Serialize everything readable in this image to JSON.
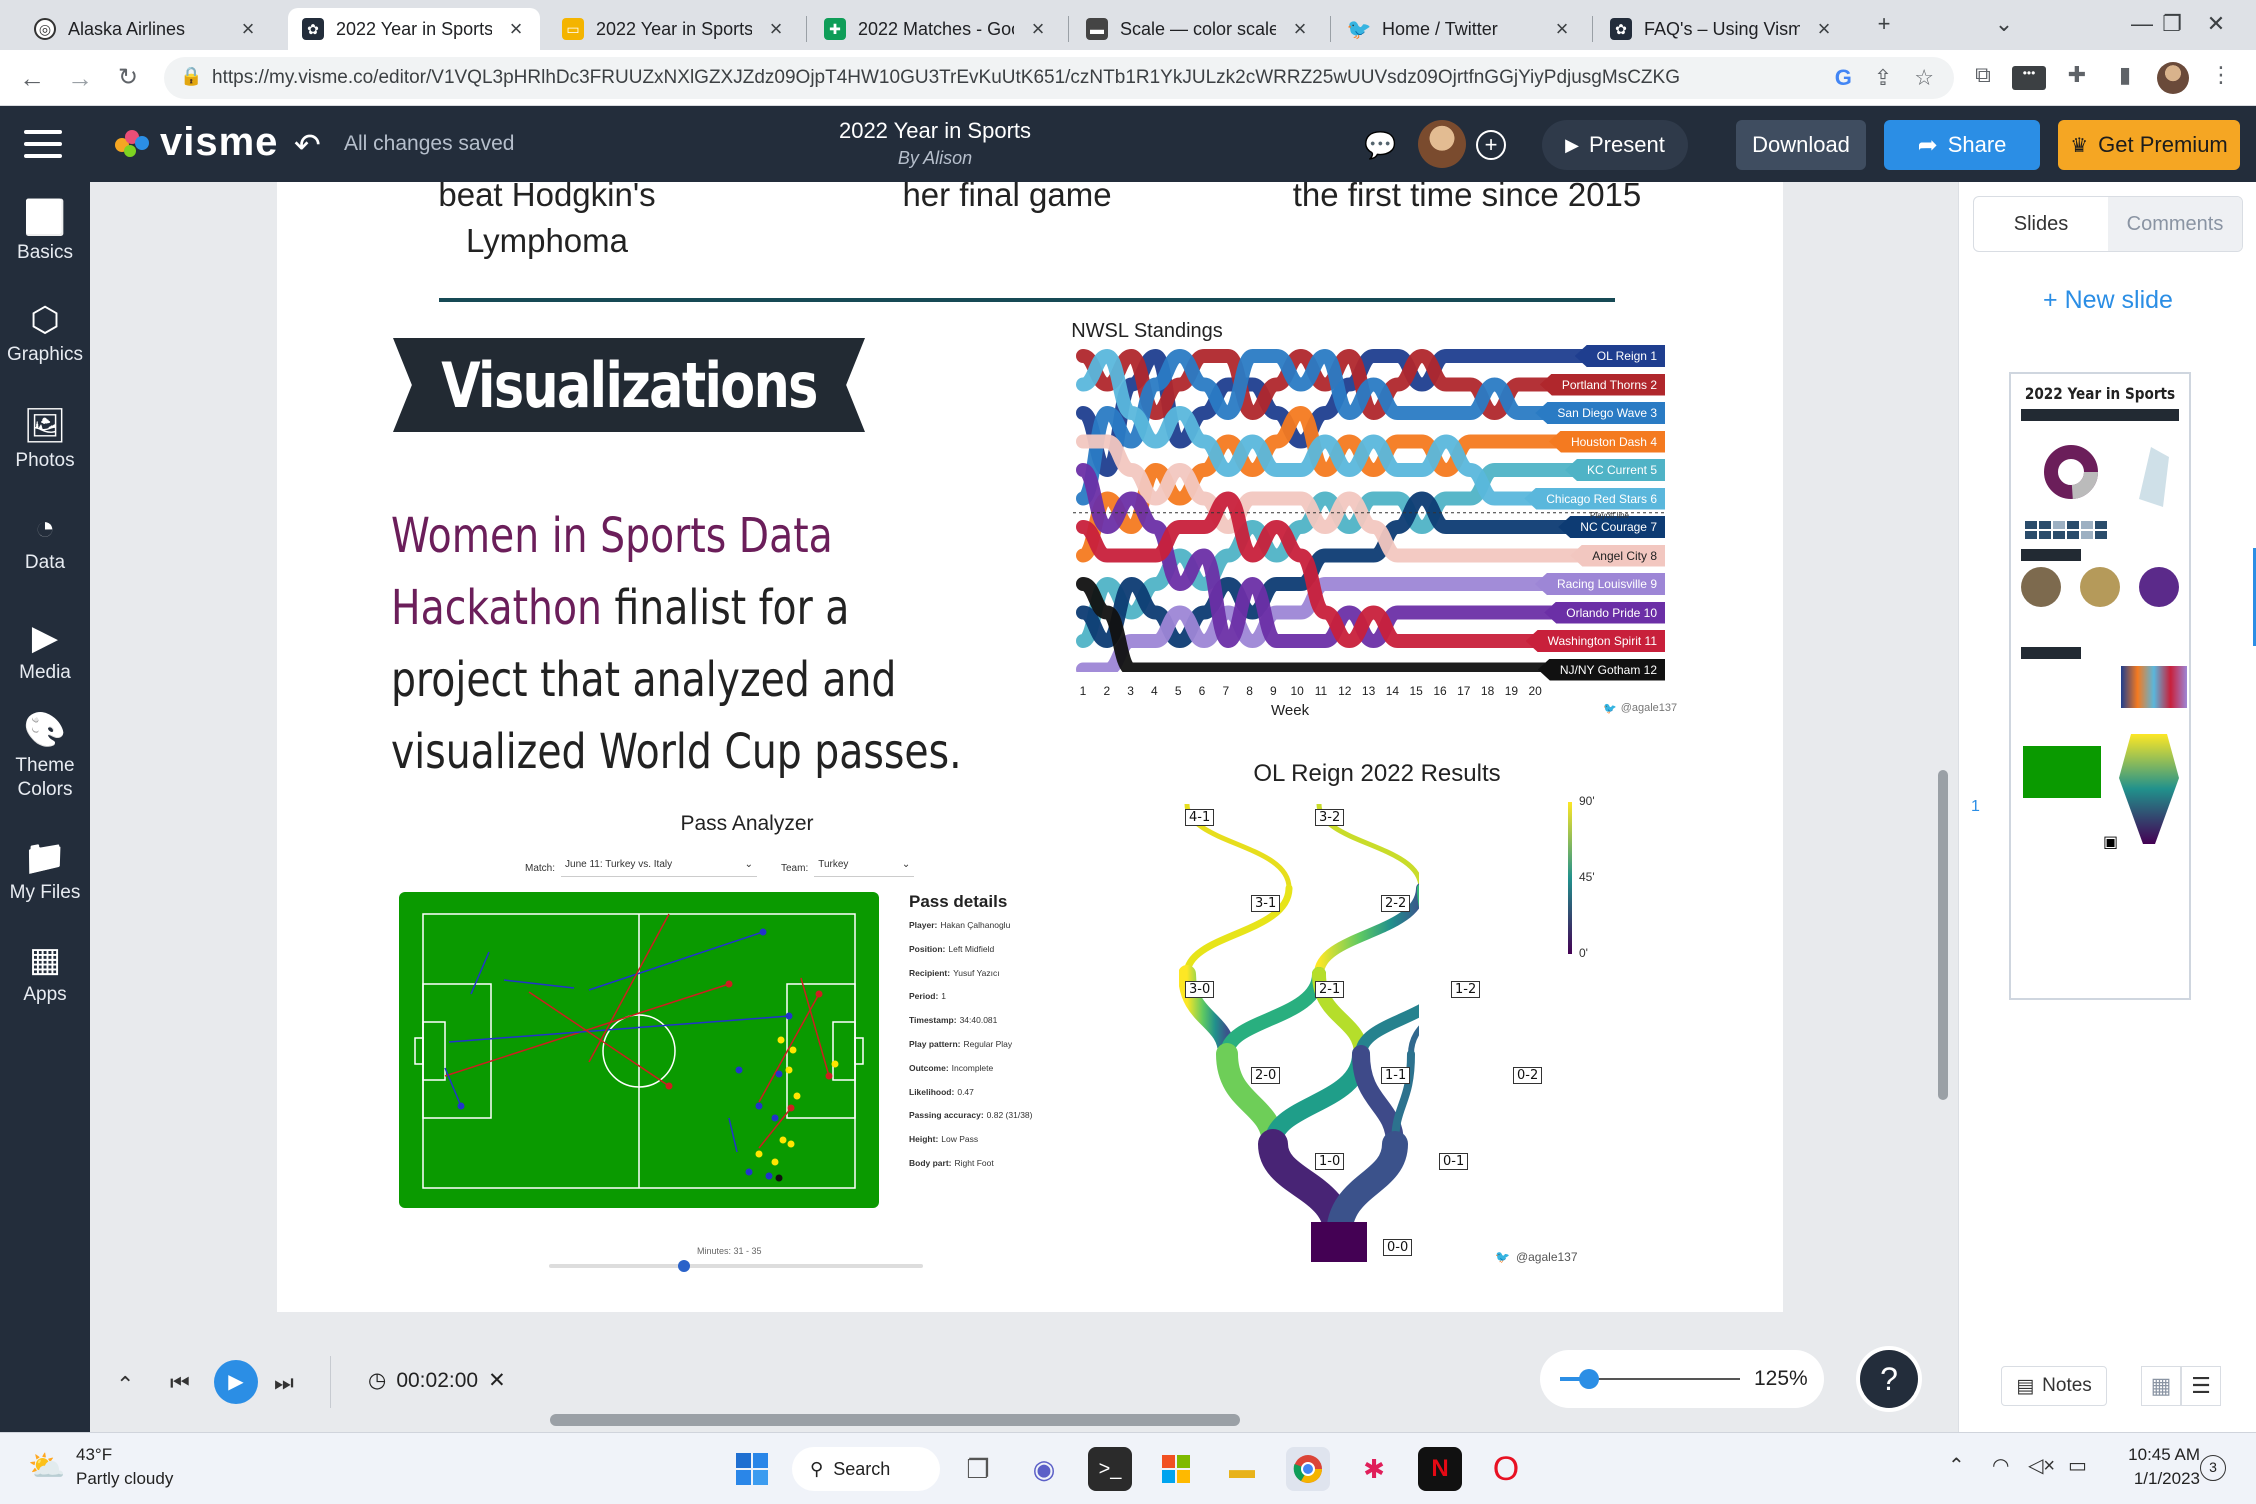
{
  "browser": {
    "tabs": [
      {
        "title": "Alaska Airlines",
        "icon": "alaska-icon",
        "active": false
      },
      {
        "title": "2022 Year in Sports",
        "icon": "visme-icon",
        "active": true
      },
      {
        "title": "2022 Year in Sports",
        "icon": "slides-icon",
        "active": false
      },
      {
        "title": "2022 Matches - Goo",
        "icon": "sheets-icon",
        "active": false
      },
      {
        "title": "Scale — color scale",
        "icon": "scale-icon",
        "active": false
      },
      {
        "title": "Home / Twitter",
        "icon": "twitter-icon",
        "active": false
      },
      {
        "title": "FAQ's – Using Visme",
        "icon": "visme-icon",
        "active": false
      }
    ],
    "url": "https://my.visme.co/editor/V1VQL3pHRlhDc3FRUUZxNXlGZXJZdz09OjpT4HW10GU3TrEvKuUtK651/czNTb1R1YkJULzk2cWRRZ25wUUVsdz09OjrtfnGGjYiyPdjusgMsCZKG"
  },
  "app": {
    "logo": "visme",
    "save_status": "All changes saved",
    "doc_title": "2022 Year in Sports",
    "doc_subtitle": "By Alison",
    "present_label": "Present",
    "download_label": "Download",
    "share_label": "Share",
    "premium_label": "Get Premium",
    "accent": "#2b8ee5",
    "premium_color": "#f5a623"
  },
  "sidebar": {
    "items": [
      {
        "label": "Basics",
        "icon": "basics-icon"
      },
      {
        "label": "Graphics",
        "icon": "graphics-icon"
      },
      {
        "label": "Photos",
        "icon": "photos-icon"
      },
      {
        "label": "Data",
        "icon": "data-icon"
      },
      {
        "label": "Media",
        "icon": "media-icon"
      },
      {
        "label": "Theme Colors",
        "icon": "palette-icon"
      },
      {
        "label": "My Files",
        "icon": "files-icon"
      },
      {
        "label": "Apps",
        "icon": "apps-icon"
      }
    ]
  },
  "slide": {
    "top_captions": [
      "beat Hodgkin's",
      "Lymphoma",
      "her final game",
      "the first time since 2015"
    ],
    "section_banner": "Visualizations",
    "hackathon_highlight_1": "Women in Sports Data",
    "hackathon_highlight_2": "Hackathon",
    "hackathon_rest_1": " finalist for a",
    "hackathon_rest_2": "project that analyzed and",
    "hackathon_rest_3": "visualized World Cup passes.",
    "nwsl": {
      "title": "NWSL Standings",
      "x_label": "Week",
      "weeks": [
        "1",
        "2",
        "3",
        "4",
        "5",
        "6",
        "7",
        "8",
        "9",
        "10",
        "11",
        "12",
        "13",
        "14",
        "15",
        "16",
        "17",
        "18",
        "19",
        "20"
      ],
      "playoff_line": "Playoff line",
      "teams": [
        {
          "label": "OL Reign 1",
          "color": "#1f3e8f"
        },
        {
          "label": "Portland Thorns 2",
          "color": "#b0272c"
        },
        {
          "label": "San Diego Wave 3",
          "color": "#2a7bc4"
        },
        {
          "label": "Houston Dash 4",
          "color": "#f47a20"
        },
        {
          "label": "KC Current 5",
          "color": "#4fb3c6"
        },
        {
          "label": "Chicago Red Stars 6",
          "color": "#5ab7dc"
        },
        {
          "label": "NC Courage 7",
          "color": "#0d3b73"
        },
        {
          "label": "Angel City 8",
          "color": "#f2c7c0"
        },
        {
          "label": "Racing Louisville 9",
          "color": "#9d86d6"
        },
        {
          "label": "Orlando Pride 10",
          "color": "#6b2fa6"
        },
        {
          "label": "Washington Spirit 11",
          "color": "#c8203b"
        },
        {
          "label": "NJ/NY Gotham 12",
          "color": "#111111"
        }
      ],
      "credit": "@agale137"
    },
    "pass": {
      "title": "Pass Analyzer",
      "match_label": "Match:",
      "match_value": "June 11: Turkey vs. Italy",
      "team_label": "Team:",
      "team_value": "Turkey",
      "details_title": "Pass details",
      "details": [
        {
          "k": "Player:",
          "v": "Hakan Çalhanoglu"
        },
        {
          "k": "Position:",
          "v": "Left Midfield"
        },
        {
          "k": "Recipient:",
          "v": "Yusuf Yazıcı"
        },
        {
          "k": "Period:",
          "v": "1"
        },
        {
          "k": "Timestamp:",
          "v": "34:40.081"
        },
        {
          "k": "Play pattern:",
          "v": "Regular Play"
        },
        {
          "k": "Outcome:",
          "v": "Incomplete"
        },
        {
          "k": "Likelihood:",
          "v": "0.47"
        },
        {
          "k": "Passing accuracy:",
          "v": "0.82 (31/38)"
        },
        {
          "k": "Height:",
          "v": "Low Pass"
        },
        {
          "k": "Body part:",
          "v": "Right Foot"
        }
      ],
      "minutes": "Minutes: 31 - 35",
      "slider_value": 0.36
    },
    "reign": {
      "title": "OL Reign 2022 Results",
      "nodes": [
        "4-1",
        "3-2",
        "3-1",
        "2-2",
        "3-0",
        "2-1",
        "1-2",
        "2-0",
        "1-1",
        "0-2",
        "1-0",
        "0-1",
        "0-0"
      ],
      "scale_labels": [
        "90'",
        "45'",
        "0'"
      ],
      "credit": "@agale137"
    }
  },
  "right_panel": {
    "tab_slides": "Slides",
    "tab_comments": "Comments",
    "new_slide": "+ New slide",
    "slide_number": "1",
    "thumb_title": "2022 Year in Sports"
  },
  "bottom": {
    "timer": "00:02:00",
    "zoom": "125%",
    "zoom_value": 0.16,
    "notes_label": "Notes",
    "help": "?"
  },
  "taskbar": {
    "weather_temp": "43°F",
    "weather_desc": "Partly cloudy",
    "search_label": "Search",
    "time": "10:45 AM",
    "date": "1/1/2023",
    "notification_count": "3"
  }
}
